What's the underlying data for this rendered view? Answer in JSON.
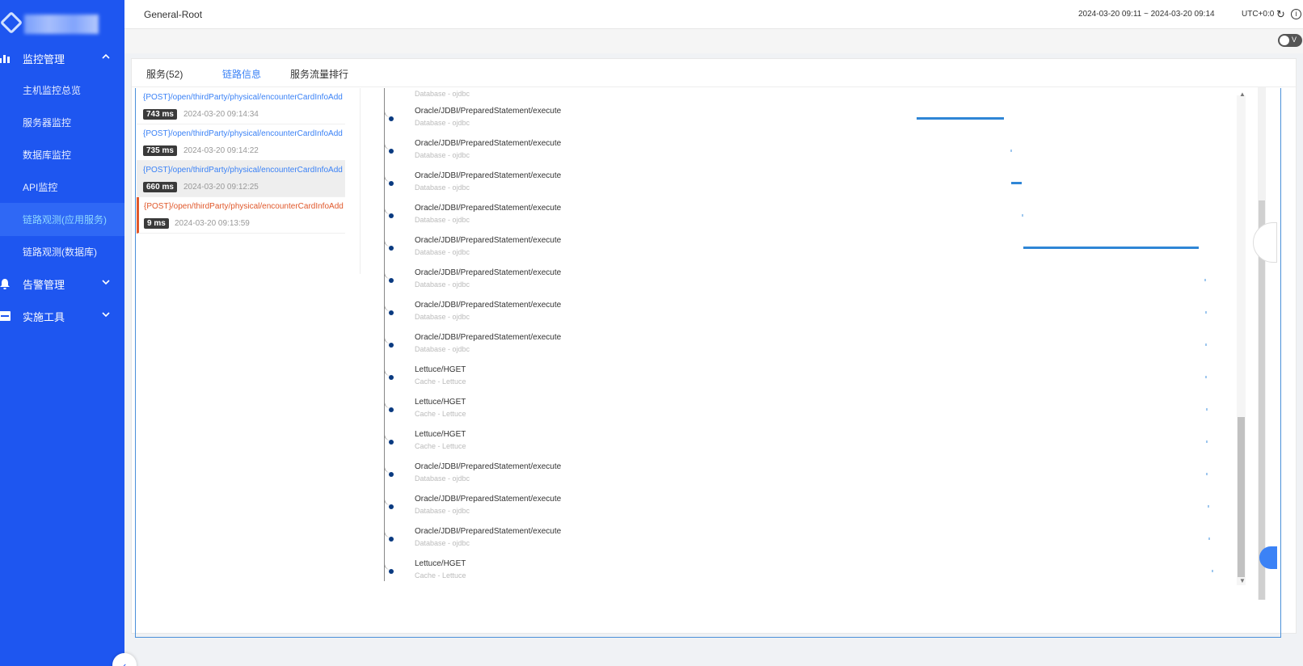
{
  "sidebar": {
    "groups": [
      {
        "label": "监控管理",
        "chevron": "^",
        "icon": "bar-chart-icon"
      },
      {
        "label": "告警管理",
        "chevron": "˅",
        "icon": "bell-icon"
      },
      {
        "label": "实施工具",
        "chevron": "˅",
        "icon": "toolbox-icon"
      }
    ],
    "items": [
      {
        "label": "主机监控总览"
      },
      {
        "label": "服务器监控"
      },
      {
        "label": "数据库监控"
      },
      {
        "label": "API监控"
      },
      {
        "label": "链路观测(应用服务)"
      },
      {
        "label": "链路观测(数据库)"
      }
    ],
    "active_index": 4,
    "colors": {
      "bg": "#1e56f0",
      "active_text": "#8fd8ff"
    }
  },
  "header": {
    "title": "General-Root",
    "time_range": "2024-03-20 09:11 ~ 2024-03-20 09:14",
    "timezone": "UTC+0:0",
    "toggle_label": "V"
  },
  "tabs": [
    {
      "label": "服务(52)",
      "active": false
    },
    {
      "label": "链路信息",
      "active": true
    },
    {
      "label": "服务流量排行",
      "active": false
    }
  ],
  "trace_list": [
    {
      "path": "{POST}/open/thirdParty/physical/encounterCardInfoAdd",
      "duration": "743 ms",
      "time": "2024-03-20 09:14:34",
      "state": "normal"
    },
    {
      "path": "{POST}/open/thirdParty/physical/encounterCardInfoAdd",
      "duration": "735 ms",
      "time": "2024-03-20 09:14:22",
      "state": "normal"
    },
    {
      "path": "{POST}/open/thirdParty/physical/encounterCardInfoAdd",
      "duration": "660 ms",
      "time": "2024-03-20 09:12:25",
      "state": "selected"
    },
    {
      "path": "{POST}/open/thirdParty/physical/encounterCardInfoAdd",
      "duration": "9 ms",
      "time": "2024-03-20 09:13:59",
      "state": "error"
    }
  ],
  "spans_header": {
    "component": "Database - ojdbc"
  },
  "spans": [
    {
      "name": "Oracle/JDBI/PreparedStatement/execute",
      "component": "Database - ojdbc"
    },
    {
      "name": "Oracle/JDBI/PreparedStatement/execute",
      "component": "Database - ojdbc"
    },
    {
      "name": "Oracle/JDBI/PreparedStatement/execute",
      "component": "Database - ojdbc"
    },
    {
      "name": "Oracle/JDBI/PreparedStatement/execute",
      "component": "Database - ojdbc"
    },
    {
      "name": "Oracle/JDBI/PreparedStatement/execute",
      "component": "Database - ojdbc"
    },
    {
      "name": "Oracle/JDBI/PreparedStatement/execute",
      "component": "Database - ojdbc"
    },
    {
      "name": "Oracle/JDBI/PreparedStatement/execute",
      "component": "Database - ojdbc"
    },
    {
      "name": "Oracle/JDBI/PreparedStatement/execute",
      "component": "Database - ojdbc"
    },
    {
      "name": "Lettuce/HGET",
      "component": "Cache - Lettuce"
    },
    {
      "name": "Lettuce/HGET",
      "component": "Cache - Lettuce"
    },
    {
      "name": "Lettuce/HGET",
      "component": "Cache - Lettuce"
    },
    {
      "name": "Oracle/JDBI/PreparedStatement/execute",
      "component": "Database - ojdbc"
    },
    {
      "name": "Oracle/JDBI/PreparedStatement/execute",
      "component": "Database - ojdbc"
    },
    {
      "name": "Oracle/JDBI/PreparedStatement/execute",
      "component": "Database - ojdbc"
    },
    {
      "name": "Lettuce/HGET",
      "component": "Cache - Lettuce"
    }
  ],
  "colors": {
    "accent": "#3b82f6",
    "error": "#e0582b",
    "bar": "#2f86d6"
  }
}
